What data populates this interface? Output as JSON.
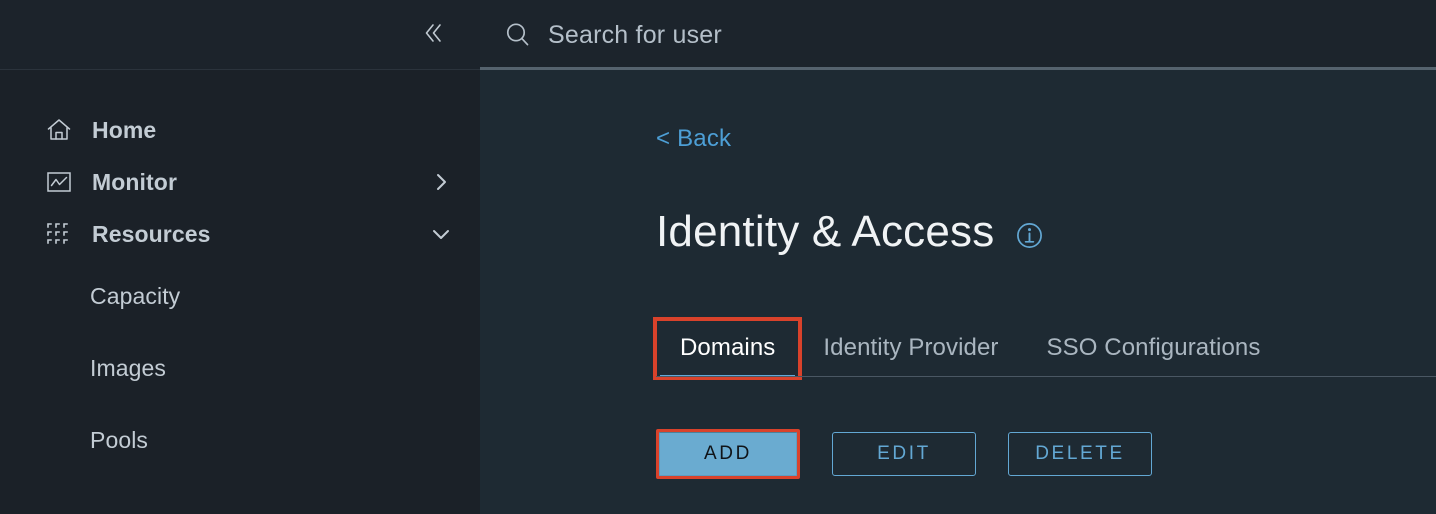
{
  "sidebar": {
    "collapse_icon": "chevron-double-left-icon",
    "items": [
      {
        "label": "Home",
        "icon": "home-icon",
        "arrow": null,
        "level": "top"
      },
      {
        "label": "Monitor",
        "icon": "monitor-chart-icon",
        "arrow": "chevron-right-icon",
        "level": "top"
      },
      {
        "label": "Resources",
        "icon": "grid-resources-icon",
        "arrow": "chevron-down-icon",
        "level": "top"
      },
      {
        "label": "Capacity",
        "icon": null,
        "arrow": null,
        "level": "sub"
      },
      {
        "label": "Images",
        "icon": null,
        "arrow": null,
        "level": "sub"
      },
      {
        "label": "Pools",
        "icon": null,
        "arrow": null,
        "level": "sub"
      }
    ]
  },
  "search": {
    "icon": "search-icon",
    "placeholder": "Search for user",
    "value": ""
  },
  "main": {
    "back_label": "< Back",
    "page_title": "Identity & Access",
    "info_icon": "info-circle-icon",
    "tabs": [
      {
        "label": "Domains",
        "active": true,
        "highlighted": true
      },
      {
        "label": "Identity Provider",
        "active": false,
        "highlighted": false
      },
      {
        "label": "SSO Configurations",
        "active": false,
        "highlighted": false
      }
    ],
    "buttons": [
      {
        "label": "ADD",
        "style": "primary",
        "highlighted": true
      },
      {
        "label": "EDIT",
        "style": "outline",
        "highlighted": false
      },
      {
        "label": "DELETE",
        "style": "outline",
        "highlighted": false
      }
    ]
  },
  "colors": {
    "sidebar_bg": "#1b2128",
    "main_bg": "#1e2a33",
    "search_bg": "#1c242c",
    "accent_blue": "#63a8d4",
    "link_blue": "#4d9fd6",
    "highlight_red": "#d9422b",
    "primary_button_bg": "#6aabd0",
    "text_primary": "#f0f3f5",
    "text_secondary": "#c3ccd4",
    "divider": "#4a5763"
  }
}
